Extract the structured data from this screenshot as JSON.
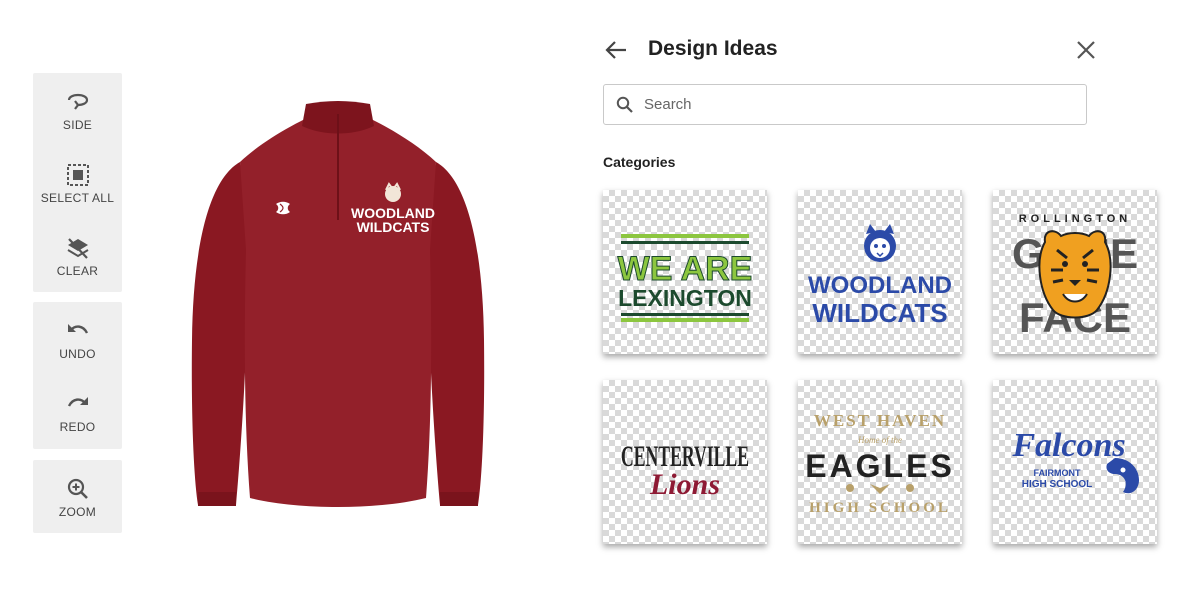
{
  "toolbar": {
    "side": "SIDE",
    "select_all": "SELECT ALL",
    "clear": "CLEAR",
    "undo": "UNDO",
    "redo": "REDO",
    "zoom": "ZOOM"
  },
  "shirt": {
    "color": "#8e1a24",
    "logo_line1": "WOODLAND",
    "logo_line2": "WILDCATS"
  },
  "panel": {
    "title": "Design Ideas",
    "search_placeholder": "Search",
    "categories_label": "Categories"
  },
  "designs": [
    {
      "line1": "WE ARE",
      "line2": "LEXINGTON"
    },
    {
      "line1": "WOODLAND",
      "line2": "WILDCATS"
    },
    {
      "top": "ROLLINGTON",
      "line1": "GAME",
      "line2": "FACE"
    },
    {
      "line1": "CENTERVILLE",
      "line2": "Lions"
    },
    {
      "top": "WEST HAVEN",
      "middle": "Home of the",
      "line1": "EAGLES",
      "bottom": "HIGH SCHOOL"
    },
    {
      "line1": "Falcons",
      "line2": "FAIRMONT",
      "line3": "HIGH SCHOOL"
    }
  ],
  "colors": {
    "toolbar_bg": "#efefef",
    "lexington_green": "#8cc63f",
    "lexington_dark": "#1c4a2e",
    "wildcats_blue": "#2b4aa8",
    "tiger_gray": "#555555",
    "lions_maroon": "#8e1a34",
    "eagles_gold": "#b8a06a",
    "falcons_blue": "#2b4aa8"
  }
}
